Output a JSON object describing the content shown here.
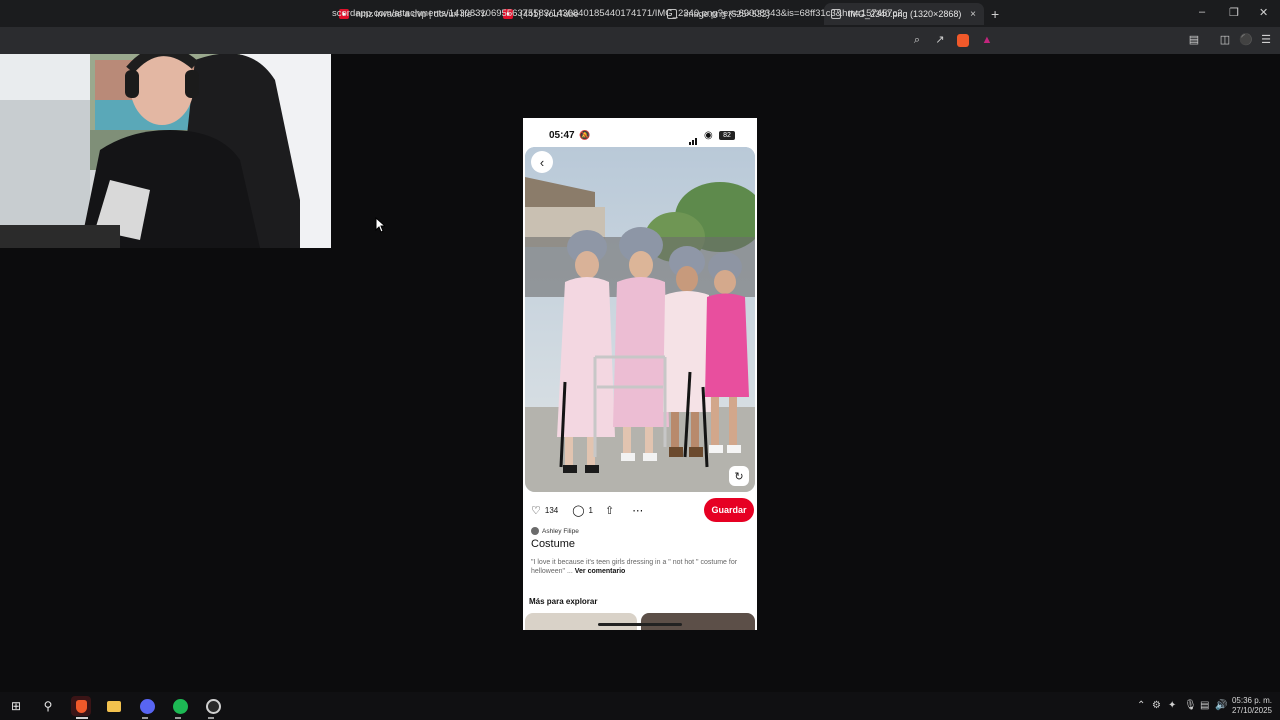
{
  "browser": {
    "tabs": [
      {
        "title": "nmz invade a dvp | dovux life - YouTu",
        "icon": "youtube-icon"
      },
      {
        "title": "(441) YouTube",
        "icon": "youtube-icon"
      },
      {
        "title": "image.png (525×532)",
        "icon": "globe-icon"
      },
      {
        "title": "IMG_2340.png (1320×2868)",
        "icon": "globe-icon",
        "active": true
      }
    ],
    "url": "scordapp.com/attachments/1430831069556375583/1430840185440174171/IMG_2340.png?ex=69008343&is=68ff31c3&hm=157457c25f...",
    "newtab_symbol": "+",
    "close_symbol": "×"
  },
  "phone": {
    "time": "05:47",
    "battery": "82",
    "likes": "134",
    "comments": "1",
    "save_label": "Guardar",
    "author": "Ashley Filipe",
    "title": "Costume",
    "comment_text": "\"I love it because it's teen girls dressing in a \" not hot \" costume for helloween\" ... ",
    "comment_link": "Ver comentario",
    "more_title": "Más para explorar"
  },
  "taskbar": {
    "clock_time": "05:36 p. m.",
    "clock_date": "27/10/2025"
  },
  "colors": {
    "accent_red": "#e60023",
    "youtube_red": "#e0112b",
    "spotify_green": "#1db954"
  }
}
